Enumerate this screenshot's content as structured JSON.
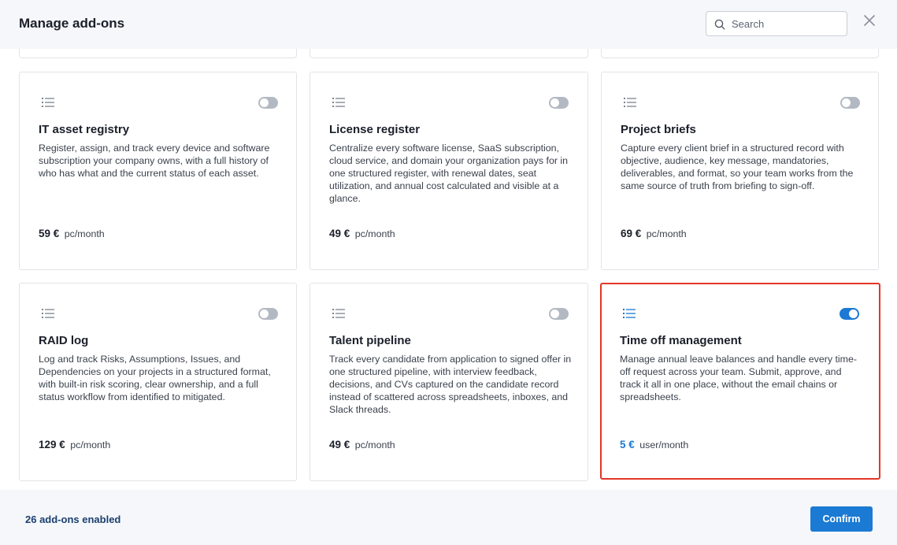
{
  "header": {
    "title": "Manage add-ons",
    "search_placeholder": "Search"
  },
  "addons": [
    {
      "title": "IT asset registry",
      "description": "Register, assign, and track every device and software subscription your company owns, with a full history of who has what and the current status of each asset.",
      "price": "59 €",
      "unit": "pc/month",
      "enabled": false
    },
    {
      "title": "License register",
      "description": "Centralize every software license, SaaS subscription, cloud service, and domain your organization pays for in one structured register, with renewal dates, seat utilization, and annual cost calculated and visible at a glance.",
      "price": "49 €",
      "unit": "pc/month",
      "enabled": false
    },
    {
      "title": "Project briefs",
      "description": "Capture every client brief in a structured record with objective, audience, key message, mandatories, deliverables, and format, so your team works from the same source of truth from briefing to sign-off.",
      "price": "69 €",
      "unit": "pc/month",
      "enabled": false
    },
    {
      "title": "RAID log",
      "description": "Log and track Risks, Assumptions, Issues, and Dependencies on your projects in a structured format, with built-in risk scoring, clear ownership, and a full status workflow from identified to mitigated.",
      "price": "129 €",
      "unit": "pc/month",
      "enabled": false
    },
    {
      "title": "Talent pipeline",
      "description": "Track every candidate from application to signed offer in one structured pipeline, with interview feedback, decisions, and CVs captured on the candidate record instead of scattered across spreadsheets, inboxes, and Slack threads.",
      "price": "49 €",
      "unit": "pc/month",
      "enabled": false
    },
    {
      "title": "Time off management",
      "description": "Manage annual leave balances and handle every time-off request across your team. Submit, approve, and track it all in one place, without the email chains or spreadsheets.",
      "price": "5 €",
      "unit": "user/month",
      "enabled": true
    }
  ],
  "footer": {
    "enabled_count": "26 add-ons enabled",
    "confirm_label": "Confirm"
  },
  "colors": {
    "accent": "#1b7ad3",
    "highlight": "#e53527",
    "toggle_off": "#b3b9c3"
  }
}
